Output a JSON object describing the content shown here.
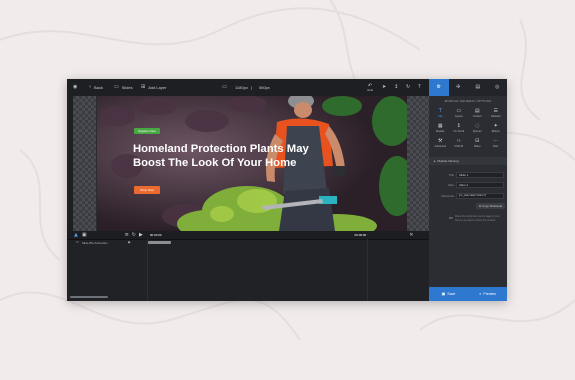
{
  "toolbar": {
    "back_label": "Back",
    "slides_label": "Slides",
    "add_layer_label": "Add Layer",
    "width_value": "1180px",
    "height_value": "560px",
    "undo_label": "Undo"
  },
  "slide": {
    "badge": "Organic Care",
    "title": "Homeland Protection Plants May Boost The Look Of Your Home",
    "button": "Shop Now"
  },
  "right_panel": {
    "heading": "MODULE GENERAL OPTIONS",
    "tiles": [
      {
        "label": "Title",
        "icon": "title-icon"
      },
      {
        "label": "Layout",
        "icon": "layout-icon"
      },
      {
        "label": "Content",
        "icon": "content-icon"
      },
      {
        "label": "Defaults",
        "icon": "defaults-icon"
      },
      {
        "label": "Module",
        "icon": "module-icon"
      },
      {
        "label": "On Scroll",
        "icon": "scroll-icon"
      },
      {
        "label": "Spinner",
        "icon": "spinner-icon"
      },
      {
        "label": "Effects",
        "icon": "effects-icon"
      },
      {
        "label": "Advanced",
        "icon": "advanced-icon"
      },
      {
        "label": "CSS/JS",
        "icon": "code-icon"
      },
      {
        "label": "Slider",
        "icon": "slider-icon"
      },
      {
        "label": "Misc",
        "icon": "misc-icon"
      }
    ],
    "section_title": "Module Naming",
    "fields": {
      "title_label": "Title",
      "title_value": "Slider 1",
      "alias_label": "Alias",
      "alias_value": "slider-1",
      "shortcode_label": "Shortcode",
      "shortcode_value": "[rev_slider alias=\"slider-1\"]"
    },
    "copy_button": "Copy Shortcode",
    "note": "Place the shortcode via the page of your theme you want to show this module.",
    "save_label": "Save",
    "preview_label": "Preview"
  },
  "timeline": {
    "layer_name": "Slide BG Animation",
    "time": "00:00:00",
    "end_time": "00:09:00",
    "accent": "#2f78d0"
  }
}
